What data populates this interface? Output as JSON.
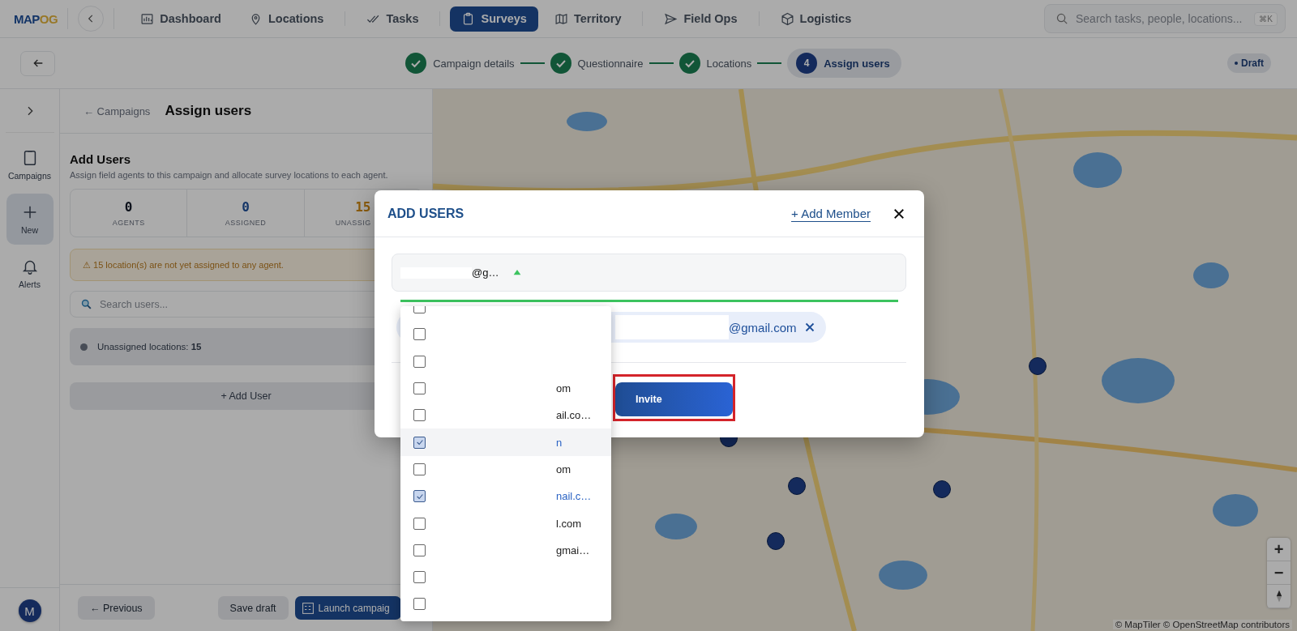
{
  "top_nav": {
    "logo": {
      "part_1": "MAP",
      "part_2": "OG"
    },
    "items": [
      {
        "label": "Dashboard",
        "selected": false
      },
      {
        "label": "Locations",
        "selected": false
      },
      {
        "label": "Tasks",
        "selected": false
      },
      {
        "label": "Surveys",
        "selected": true
      },
      {
        "label": "Territory",
        "selected": false
      },
      {
        "label": "Field Ops",
        "selected": false
      },
      {
        "label": "Logistics",
        "selected": false
      }
    ],
    "search": {
      "placeholder": "Search tasks, people, locations...",
      "shortcut": "⌘K"
    }
  },
  "stepper": {
    "steps": [
      {
        "label": "Campaign details",
        "done": true
      },
      {
        "label": "Questionnaire",
        "done": true
      },
      {
        "label": "Locations",
        "done": true
      },
      {
        "label": "Assign users",
        "done": false,
        "number": "4"
      }
    ],
    "badge": "Draft"
  },
  "rail": {
    "items": [
      {
        "label": "Campaigns",
        "selected": false
      },
      {
        "label": "New",
        "selected": true
      },
      {
        "label": "Alerts",
        "selected": false
      }
    ],
    "avatar": "M"
  },
  "panel": {
    "breadcrumb": "← Campaigns",
    "title": "Assign users",
    "section_title": "Add Users",
    "description": "Assign field agents to this campaign and allocate survey locations to each agent.",
    "stats": [
      {
        "value": "0",
        "label": "AGENTS"
      },
      {
        "value": "0",
        "label": "ASSIGNED"
      },
      {
        "value": "15",
        "label": "UNASSIG"
      }
    ],
    "alert": "⚠ 15 location(s) are not yet assigned to any agent.",
    "search": {
      "placeholder": "Search users..."
    },
    "unassigned": "Unassigned locations: **15**",
    "add_user": "+ Add User",
    "footer": {
      "previous": "← Previous",
      "save": "Save draft",
      "launch": "Launch campaig"
    }
  },
  "modal": {
    "title": "ADD USERS",
    "add_member": "+ Add Member",
    "select_value": "@g…",
    "chip": "@gmail.com",
    "invite": "Invite",
    "options": [
      {
        "checked": false,
        "highlighted": false
      },
      {
        "checked": false,
        "highlighted": false
      },
      {
        "checked": false,
        "highlighted": false
      },
      {
        "text": "om",
        "checked": false,
        "highlighted": false
      },
      {
        "text": "ail.co…",
        "checked": false,
        "highlighted": false
      },
      {
        "text": "n",
        "checked": true,
        "highlighted": true
      },
      {
        "text": "om",
        "checked": false,
        "highlighted": false
      },
      {
        "text": "nail.c…",
        "checked": true,
        "highlighted": false
      },
      {
        "text": "l.com",
        "checked": false,
        "highlighted": false
      },
      {
        "text": "gmai…",
        "checked": false,
        "highlighted": false
      },
      {
        "checked": false,
        "highlighted": false
      },
      {
        "checked": false,
        "highlighted": false
      }
    ]
  },
  "map": {
    "zoom_in": "+",
    "zoom_out": "−",
    "attribution": "© MapTiler © OpenStreetMap contributors"
  }
}
